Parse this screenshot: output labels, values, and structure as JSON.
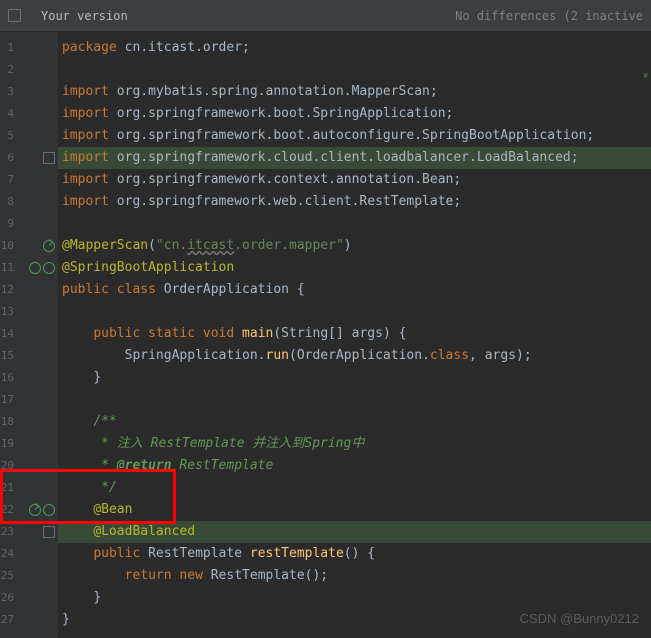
{
  "header": {
    "label": "Your version",
    "right_text": "No differences (2 inactive"
  },
  "lines": [
    "1",
    "2",
    "3",
    "4",
    "5",
    "6",
    "7",
    "8",
    "9",
    "10",
    "11",
    "12",
    "13",
    "14",
    "15",
    "16",
    "17",
    "18",
    "19",
    "20",
    "21",
    "22",
    "23",
    "24",
    "25",
    "26",
    "27"
  ],
  "code": {
    "l1": {
      "kw": "package",
      "rest": " cn.itcast.order;"
    },
    "l3_kw": "import",
    "l3_rest": " org.mybatis.spring.annotation.MapperScan;",
    "l4_kw": "import",
    "l4_rest": " org.springframework.boot.SpringApplication;",
    "l5_kw": "import",
    "l5_rest": " org.springframework.boot.autoconfigure.SpringBootApplication;",
    "l6_kw": "import",
    "l6_rest": " org.springframework.cloud.client.loadbalancer.LoadBalanced;",
    "l7_kw": "import",
    "l7_rest": " org.springframework.context.annotation.Bean;",
    "l8_kw": "import",
    "l8_rest": " org.springframework.web.client.RestTemplate;",
    "l10_ann": "@MapperScan",
    "l10_p": "(",
    "l10_s": "\"cn.",
    "l10_it": "itcast",
    "l10_s2": ".order.mapper\"",
    "l10_cp": ")",
    "l11_ann": "@SpringBootApplication",
    "l12_pub": "public ",
    "l12_cls": "class ",
    "l12_name": "OrderApplication ",
    "l12_b": "{",
    "l14_pub": "public ",
    "l14_st": "static ",
    "l14_vd": "void ",
    "l14_fn": "main",
    "l14_p": "(String[] ",
    "l14_arg": "args",
    "l14_cp": ") {",
    "l15_a": "SpringApplication.",
    "l15_fn": "run",
    "l15_p": "(OrderApplication.",
    "l15_cls": "class",
    "l15_c": ", ",
    "l15_arg": "args",
    "l15_cp": ");",
    "l16": "}",
    "l18": "/**",
    "l19": " * 注入 RestTemplate 并注入到Spring中",
    "l20a": " * ",
    "l20b": "@return",
    "l20c": " RestTemplate",
    "l21": " */",
    "l22": "@Bean",
    "l23": "@LoadBalanced",
    "l24_pub": "public ",
    "l24_t": "RestTemplate ",
    "l24_fn": "restTemplate",
    "l24_p": "() {",
    "l25_ret": "return ",
    "l25_new": "new ",
    "l25_t": "RestTemplate",
    "l25_p": "();",
    "l26": "}",
    "l27": "}"
  },
  "watermark": "CSDN @Bunny0212"
}
